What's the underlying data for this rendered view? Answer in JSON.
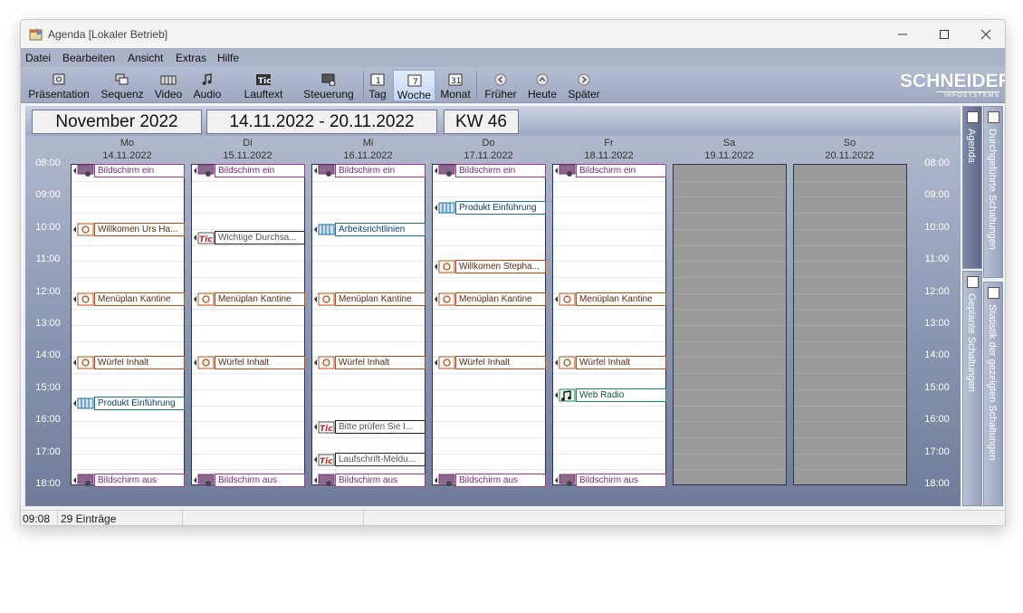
{
  "window": {
    "title": "Agenda [Lokaler Betrieb]"
  },
  "menu": [
    "Datei",
    "Bearbeiten",
    "Ansicht",
    "Extras",
    "Hilfe"
  ],
  "toolbar": [
    {
      "label": "Präsentation",
      "icon": "presentation-icon"
    },
    {
      "label": "Sequenz",
      "icon": "sequence-icon"
    },
    {
      "label": "Video",
      "icon": "video-icon"
    },
    {
      "label": "Audio",
      "icon": "audio-icon"
    },
    {
      "label": "Lauftext",
      "icon": "ticker-icon"
    },
    {
      "label": "Steuerung",
      "icon": "control-icon"
    },
    {
      "label": "Tag",
      "icon": "day-icon"
    },
    {
      "label": "Woche",
      "icon": "week-icon",
      "active": true
    },
    {
      "label": "Monat",
      "icon": "month-icon"
    },
    {
      "label": "Früher",
      "icon": "back-icon"
    },
    {
      "label": "Heute",
      "icon": "today-icon"
    },
    {
      "label": "Später",
      "icon": "forward-icon"
    }
  ],
  "logo": {
    "big": "SCHNEIDER",
    "small": "INFOSYSTEMS"
  },
  "header": {
    "month": "November 2022",
    "range": "14.11.2022 - 20.11.2022",
    "week": "KW 46"
  },
  "days": [
    {
      "name": "Mo",
      "date": "14.11.2022"
    },
    {
      "name": "Di",
      "date": "15.11.2022"
    },
    {
      "name": "Mi",
      "date": "16.11.2022"
    },
    {
      "name": "Do",
      "date": "17.11.2022"
    },
    {
      "name": "Fr",
      "date": "18.11.2022"
    },
    {
      "name": "Sa",
      "date": "19.11.2022"
    },
    {
      "name": "So",
      "date": "20.11.2022"
    }
  ],
  "times": [
    "08:00",
    "09:00",
    "10:00",
    "11:00",
    "12:00",
    "13:00",
    "14:00",
    "15:00",
    "16:00",
    "17:00",
    "18:00"
  ],
  "events": [
    {
      "day": 0,
      "time": "08:00",
      "type": "ctrl",
      "label": "Bildschirm ein"
    },
    {
      "day": 0,
      "time": "09:50",
      "type": "pres",
      "label": "Willkomen Urs Ha..."
    },
    {
      "day": 0,
      "time": "12:00",
      "type": "pres",
      "label": "Menüplan Kantine"
    },
    {
      "day": 0,
      "time": "14:00",
      "type": "pres",
      "label": "Würfel Inhalt"
    },
    {
      "day": 0,
      "time": "15:15",
      "type": "vid",
      "label": "Produkt Einführung"
    },
    {
      "day": 0,
      "time": "17:40",
      "type": "ctrl",
      "label": "Bildschirm aus"
    },
    {
      "day": 1,
      "time": "08:00",
      "type": "ctrl",
      "label": "Bildschirm ein"
    },
    {
      "day": 1,
      "time": "10:05",
      "type": "tic",
      "label": "Wichtige Durchsa..."
    },
    {
      "day": 1,
      "time": "12:00",
      "type": "pres",
      "label": "Menüplan Kantine"
    },
    {
      "day": 1,
      "time": "14:00",
      "type": "pres",
      "label": "Würfel Inhalt"
    },
    {
      "day": 1,
      "time": "17:40",
      "type": "ctrl",
      "label": "Bildschirm aus"
    },
    {
      "day": 2,
      "time": "08:00",
      "type": "ctrl",
      "label": "Bildschirm ein"
    },
    {
      "day": 2,
      "time": "09:50",
      "type": "vid",
      "label": "Arbeitsrichtlinien"
    },
    {
      "day": 2,
      "time": "12:00",
      "type": "pres",
      "label": "Menüplan Kantine"
    },
    {
      "day": 2,
      "time": "14:00",
      "type": "pres",
      "label": "Würfel Inhalt"
    },
    {
      "day": 2,
      "time": "16:00",
      "type": "tic",
      "label": "Bitte prüfen Sie I..."
    },
    {
      "day": 2,
      "time": "17:00",
      "type": "tic",
      "label": "Laufschrift-Meldu..."
    },
    {
      "day": 2,
      "time": "17:40",
      "type": "ctrl",
      "label": "Bildschirm aus"
    },
    {
      "day": 3,
      "time": "08:00",
      "type": "ctrl",
      "label": "Bildschirm ein"
    },
    {
      "day": 3,
      "time": "09:10",
      "type": "vid",
      "label": "Produkt Einführung"
    },
    {
      "day": 3,
      "time": "11:00",
      "type": "pres",
      "label": "Willkomen Stepha..."
    },
    {
      "day": 3,
      "time": "12:00",
      "type": "pres",
      "label": "Menüplan Kantine"
    },
    {
      "day": 3,
      "time": "14:00",
      "type": "pres",
      "label": "Würfel Inhalt"
    },
    {
      "day": 3,
      "time": "17:40",
      "type": "ctrl",
      "label": "Bildschirm aus"
    },
    {
      "day": 4,
      "time": "08:00",
      "type": "ctrl",
      "label": "Bildschirm ein"
    },
    {
      "day": 4,
      "time": "12:00",
      "type": "pres",
      "label": "Menüplan Kantine"
    },
    {
      "day": 4,
      "time": "14:00",
      "type": "pres",
      "label": "Würfel Inhalt"
    },
    {
      "day": 4,
      "time": "15:00",
      "type": "aud",
      "label": "Web Radio"
    },
    {
      "day": 4,
      "time": "17:40",
      "type": "ctrl",
      "label": "Bildschirm aus"
    }
  ],
  "sidetabs": [
    {
      "label": "Agenda",
      "active": true
    },
    {
      "label": "Geplante Schaltungen"
    },
    {
      "label": "Durchgeführte Schaltungen"
    },
    {
      "label": "Statistik der gezeigten Schaltungen"
    }
  ],
  "status": {
    "time": "09:08",
    "count": "29 Einträge"
  }
}
